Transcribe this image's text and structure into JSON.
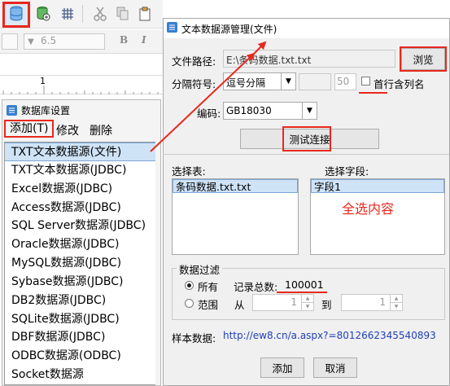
{
  "toolbar": {
    "font_size": "6.5",
    "format_buttons": [
      "B",
      "I"
    ]
  },
  "ruler": {
    "mark": "1"
  },
  "db_panel": {
    "title": "数据库设置",
    "menu": {
      "add": "添加(T)",
      "edit": "修改",
      "delete": "删除"
    },
    "datasources": [
      "TXT文本数据源(文件)",
      "TXT文本数据源(JDBC)",
      "Excel数据源(JDBC)",
      "Access数据源(JDBC)",
      "SQL Server数据源(JDBC)",
      "Oracle数据源(JDBC)",
      "MySQL数据源(JDBC)",
      "Sybase数据源(JDBC)",
      "DB2数据源(JDBC)",
      "SQLite数据源(JDBC)",
      "DBF数据源(JDBC)",
      "ODBC数据源(ODBC)",
      "Socket数据源"
    ],
    "selected_index": 0
  },
  "dialog": {
    "title": "文本数据源管理(文件)",
    "file_path_label": "文件路径:",
    "file_path_value": "E:\\条码数据.txt.txt",
    "browse_button": "浏览",
    "separator_label": "分隔符号:",
    "separator_value": "逗号分隔",
    "separator_count": "50",
    "first_row_header_label": "首行含列名",
    "encoding_label": "编码:",
    "encoding_value": "GB18030",
    "test_button": "测试连接",
    "select_table_label": "选择表:",
    "tables": [
      "条码数据.txt.txt"
    ],
    "select_fields_label": "选择字段:",
    "fields": [
      "字段1"
    ],
    "select_all_note": "全选内容",
    "filter_group_label": "数据过滤",
    "radio_all": "所有",
    "record_total_label": "记录总数:",
    "record_total_value": "100001",
    "radio_range": "范围",
    "from_label": "从",
    "from_value": "1",
    "to_label": "到",
    "to_value": "1",
    "sample_label": "样本数据:",
    "sample_value": "http://ew8.cn/a.aspx?=8012662345540893",
    "add_button": "添加",
    "cancel_button": "取消"
  },
  "colors": {
    "annotation": "#e8281d",
    "selection": "#cfe3f7",
    "sample_link": "#1f3fb8"
  }
}
